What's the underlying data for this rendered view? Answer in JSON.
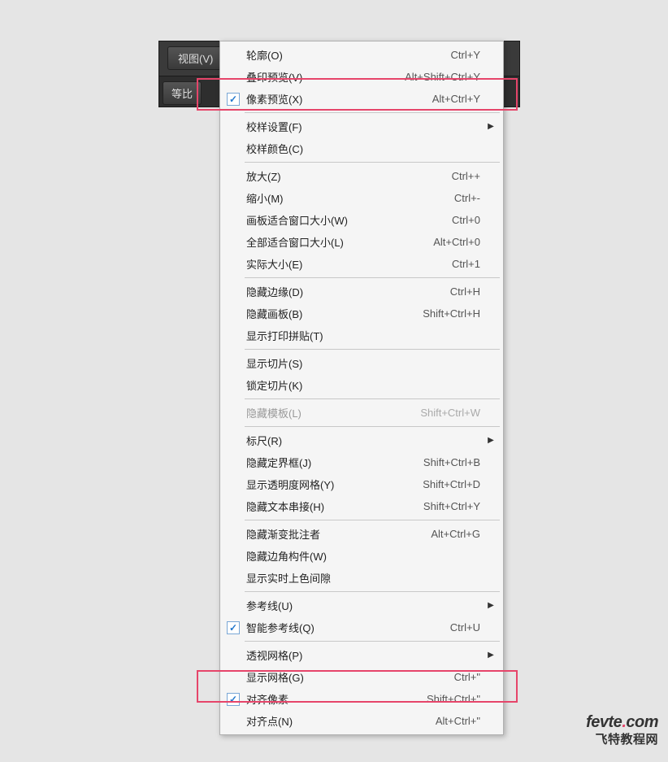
{
  "menubar": {
    "view_label": "视图(V)",
    "sub_label": "等比"
  },
  "menu": {
    "items": [
      {
        "label": "轮廓(O)",
        "shortcut": "Ctrl+Y",
        "checked": false
      },
      {
        "label": "叠印预览(V)",
        "shortcut": "Alt+Shift+Ctrl+Y",
        "checked": false
      },
      {
        "label": "像素预览(X)",
        "shortcut": "Alt+Ctrl+Y",
        "checked": true
      },
      {
        "sep": true
      },
      {
        "label": "校样设置(F)",
        "shortcut": "",
        "submenu": true
      },
      {
        "label": "校样颜色(C)",
        "shortcut": ""
      },
      {
        "sep": true
      },
      {
        "label": "放大(Z)",
        "shortcut": "Ctrl++"
      },
      {
        "label": "缩小(M)",
        "shortcut": "Ctrl+-"
      },
      {
        "label": "画板适合窗口大小(W)",
        "shortcut": "Ctrl+0"
      },
      {
        "label": "全部适合窗口大小(L)",
        "shortcut": "Alt+Ctrl+0"
      },
      {
        "label": "实际大小(E)",
        "shortcut": "Ctrl+1"
      },
      {
        "sep": true
      },
      {
        "label": "隐藏边缘(D)",
        "shortcut": "Ctrl+H"
      },
      {
        "label": "隐藏画板(B)",
        "shortcut": "Shift+Ctrl+H"
      },
      {
        "label": "显示打印拼贴(T)",
        "shortcut": ""
      },
      {
        "sep": true
      },
      {
        "label": "显示切片(S)",
        "shortcut": ""
      },
      {
        "label": "锁定切片(K)",
        "shortcut": ""
      },
      {
        "sep": true
      },
      {
        "label": "隐藏模板(L)",
        "shortcut": "Shift+Ctrl+W",
        "disabled": true
      },
      {
        "sep": true
      },
      {
        "label": "标尺(R)",
        "shortcut": "",
        "submenu": true
      },
      {
        "label": "隐藏定界框(J)",
        "shortcut": "Shift+Ctrl+B"
      },
      {
        "label": "显示透明度网格(Y)",
        "shortcut": "Shift+Ctrl+D"
      },
      {
        "label": "隐藏文本串接(H)",
        "shortcut": "Shift+Ctrl+Y"
      },
      {
        "sep": true
      },
      {
        "label": "隐藏渐变批注者",
        "shortcut": "Alt+Ctrl+G"
      },
      {
        "label": "隐藏边角构件(W)",
        "shortcut": ""
      },
      {
        "label": "显示实时上色间隙",
        "shortcut": ""
      },
      {
        "sep": true
      },
      {
        "label": "参考线(U)",
        "shortcut": "",
        "submenu": true
      },
      {
        "label": "智能参考线(Q)",
        "shortcut": "Ctrl+U",
        "checked": true
      },
      {
        "sep": true
      },
      {
        "label": "透视网格(P)",
        "shortcut": "",
        "submenu": true
      },
      {
        "label": "显示网格(G)",
        "shortcut": "Ctrl+\""
      },
      {
        "label": "对齐像素",
        "shortcut": "Shift+Ctrl+\"",
        "checked": true
      },
      {
        "label": "对齐点(N)",
        "shortcut": "Alt+Ctrl+\""
      }
    ]
  },
  "watermark": {
    "url": "fevte.com",
    "text": "飞特教程网"
  }
}
